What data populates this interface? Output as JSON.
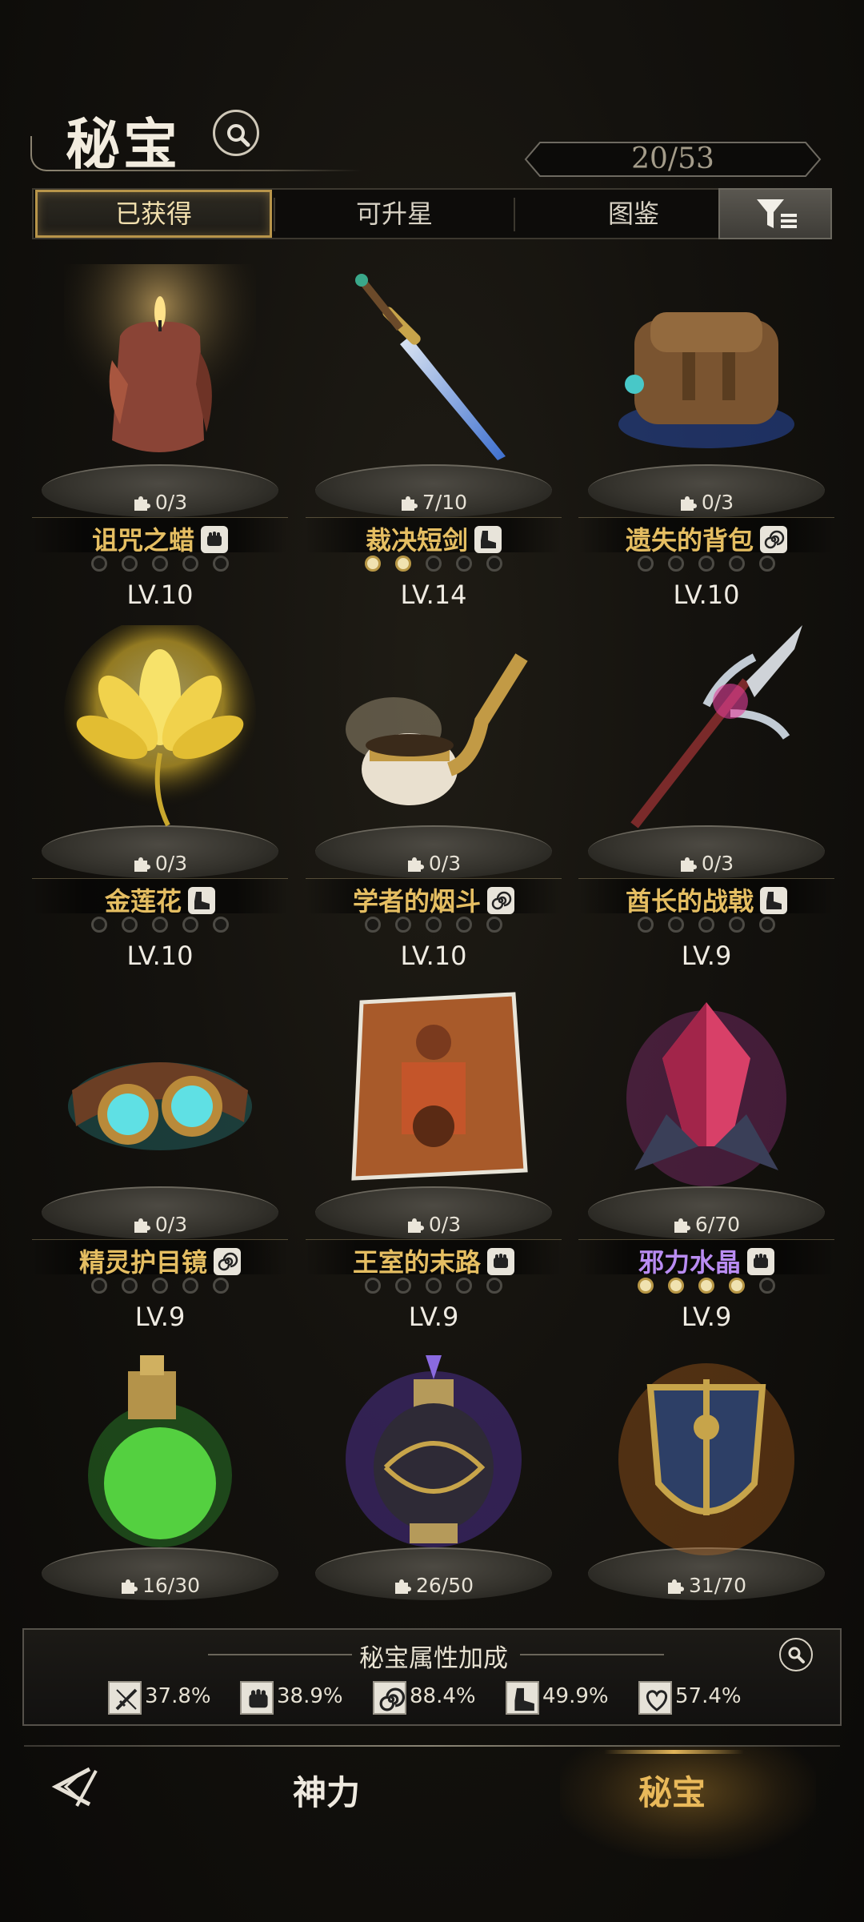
{
  "header": {
    "title": "秘宝",
    "counter": "20/53"
  },
  "tabs": [
    "已获得",
    "可升星",
    "图鉴"
  ],
  "items": [
    {
      "name": "诅咒之蜡",
      "fragments": "0/3",
      "level": "LV.10",
      "type": "fist",
      "stars_filled": 0,
      "art": "candle",
      "name_color": "gold"
    },
    {
      "name": "裁决短剑",
      "fragments": "7/10",
      "level": "LV.14",
      "type": "boot",
      "stars_filled": 2,
      "art": "dagger",
      "name_color": "gold"
    },
    {
      "name": "遗失的背包",
      "fragments": "0/3",
      "level": "LV.10",
      "type": "spiral",
      "stars_filled": 0,
      "art": "backpack",
      "name_color": "gold"
    },
    {
      "name": "金莲花",
      "fragments": "0/3",
      "level": "LV.10",
      "type": "boot",
      "stars_filled": 0,
      "art": "lotus",
      "name_color": "gold"
    },
    {
      "name": "学者的烟斗",
      "fragments": "0/3",
      "level": "LV.10",
      "type": "spiral",
      "stars_filled": 0,
      "art": "pipe",
      "name_color": "gold"
    },
    {
      "name": "酋长的战戟",
      "fragments": "0/3",
      "level": "LV.9",
      "type": "boot",
      "stars_filled": 0,
      "art": "halberd",
      "name_color": "gold"
    },
    {
      "name": "精灵护目镜",
      "fragments": "0/3",
      "level": "LV.9",
      "type": "spiral",
      "stars_filled": 0,
      "art": "goggles",
      "name_color": "gold"
    },
    {
      "name": "王室的末路",
      "fragments": "0/3",
      "level": "LV.9",
      "type": "fist",
      "stars_filled": 0,
      "art": "painting",
      "name_color": "gold"
    },
    {
      "name": "邪力水晶",
      "fragments": "6/70",
      "level": "LV.9",
      "type": "fist",
      "stars_filled": 4,
      "art": "crystal",
      "name_color": "purple"
    },
    {
      "name": "",
      "fragments": "16/30",
      "level": "",
      "type": "",
      "stars_filled": 0,
      "art": "potion",
      "name_color": "gold"
    },
    {
      "name": "",
      "fragments": "26/50",
      "level": "",
      "type": "",
      "stars_filled": 0,
      "art": "vase",
      "name_color": "gold"
    },
    {
      "name": "",
      "fragments": "31/70",
      "level": "",
      "type": "",
      "stars_filled": 0,
      "art": "shield",
      "name_color": "gold"
    }
  ],
  "bonus": {
    "title": "秘宝属性加成",
    "stats": [
      {
        "icon": "sword",
        "value": "37.8%"
      },
      {
        "icon": "fist",
        "value": "38.9%"
      },
      {
        "icon": "spiral",
        "value": "88.4%"
      },
      {
        "icon": "boot",
        "value": "49.9%"
      },
      {
        "icon": "heart",
        "value": "57.4%"
      }
    ]
  },
  "nav": {
    "left": "神力",
    "right": "秘宝"
  }
}
